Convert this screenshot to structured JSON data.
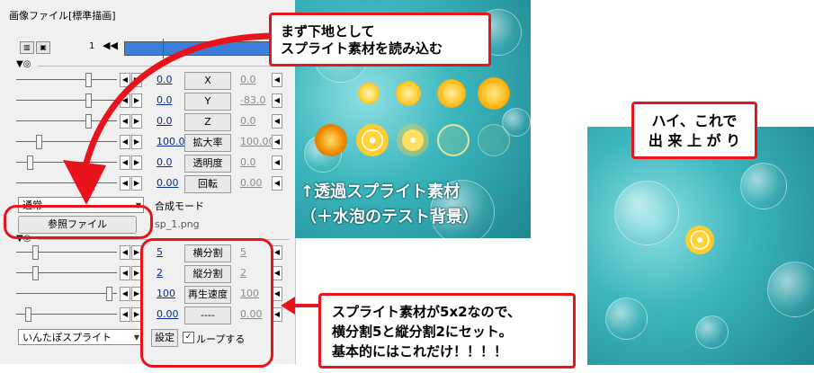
{
  "window": {
    "title": "画像ファイル[標準描画]"
  },
  "toolbar": {
    "frame_number": "1",
    "prev_icon": "double-left-arrow"
  },
  "params_standard": [
    {
      "value": "0.0",
      "name": "X",
      "end_value": "0.0"
    },
    {
      "value": "0.0",
      "name": "Y",
      "end_value": "-83.0"
    },
    {
      "value": "0.0",
      "name": "Z",
      "end_value": "0.0"
    },
    {
      "value": "100.00",
      "name": "拡大率",
      "end_value": "100.00"
    },
    {
      "value": "0.0",
      "name": "透明度",
      "end_value": "0.0"
    },
    {
      "value": "0.00",
      "name": "回転",
      "end_value": "0.00"
    }
  ],
  "blend": {
    "selected": "通常",
    "label": "合成モード"
  },
  "file": {
    "button_label": "参照ファイル",
    "filename": "sp_1.png"
  },
  "params_sprite": [
    {
      "value": "5",
      "name": "横分割",
      "end_value": "5"
    },
    {
      "value": "2",
      "name": "縦分割",
      "end_value": "2"
    },
    {
      "value": "100",
      "name": "再生速度",
      "end_value": "100"
    },
    {
      "value": "0.00",
      "name": "----",
      "end_value": "0.00"
    }
  ],
  "effect": {
    "selected": "いんたぽスプライト",
    "settings_button": "設定",
    "loop_checked": true,
    "loop_label": "ループする"
  },
  "callouts": {
    "top_line1": "まず下地として",
    "top_line2": "スプライト素材を読み込む",
    "right_line1": "ハイ、これで",
    "right_line2": "出 来 上 が り",
    "bottom_line1": "スプライト素材が5x2なので、",
    "bottom_line2": "横分割5と縦分割2にセット。",
    "bottom_line3": "基本的にはこれだけ！！！！"
  },
  "captions": {
    "sprite_line1": "↑透過スプライト素材",
    "sprite_line2": "（＋水泡のテスト背景）"
  },
  "colors": {
    "accent_red": "#e8141c",
    "timeline_blue": "#3b7fd8",
    "water": "#3cb7bd"
  }
}
